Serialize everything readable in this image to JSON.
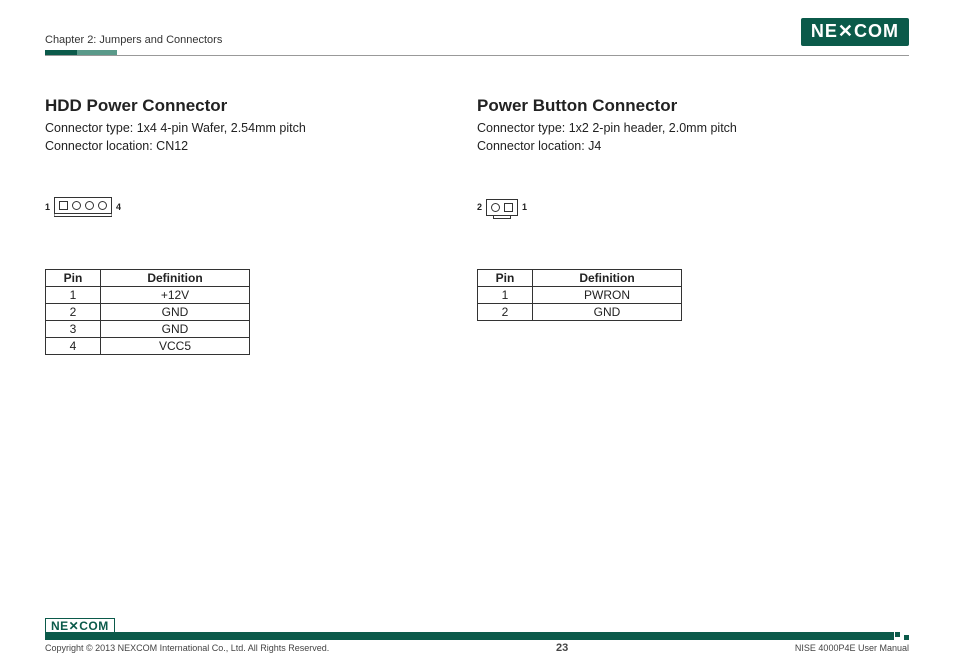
{
  "header": {
    "chapter": "Chapter 2: Jumpers and Connectors",
    "logo_text": "NE✕COM"
  },
  "left": {
    "title": "HDD Power Connector",
    "type_line": "Connector type: 1x4 4-pin Wafer, 2.54mm pitch",
    "loc_line": "Connector location: CN12",
    "diag_left_label": "1",
    "diag_right_label": "4",
    "table": {
      "headers": {
        "pin": "Pin",
        "def": "Definition"
      },
      "rows": [
        {
          "pin": "1",
          "def": "+12V"
        },
        {
          "pin": "2",
          "def": "GND"
        },
        {
          "pin": "3",
          "def": "GND"
        },
        {
          "pin": "4",
          "def": "VCC5"
        }
      ]
    }
  },
  "right": {
    "title": "Power Button Connector",
    "type_line": "Connector type: 1x2 2-pin header, 2.0mm pitch",
    "loc_line": "Connector location: J4",
    "diag_left_label": "2",
    "diag_right_label": "1",
    "table": {
      "headers": {
        "pin": "Pin",
        "def": "Definition"
      },
      "rows": [
        {
          "pin": "1",
          "def": "PWRON"
        },
        {
          "pin": "2",
          "def": "GND"
        }
      ]
    }
  },
  "footer": {
    "logo_text": "NE✕COM",
    "copyright": "Copyright © 2013 NEXCOM International Co., Ltd. All Rights Reserved.",
    "page": "23",
    "manual": "NISE 4000P4E User Manual"
  }
}
